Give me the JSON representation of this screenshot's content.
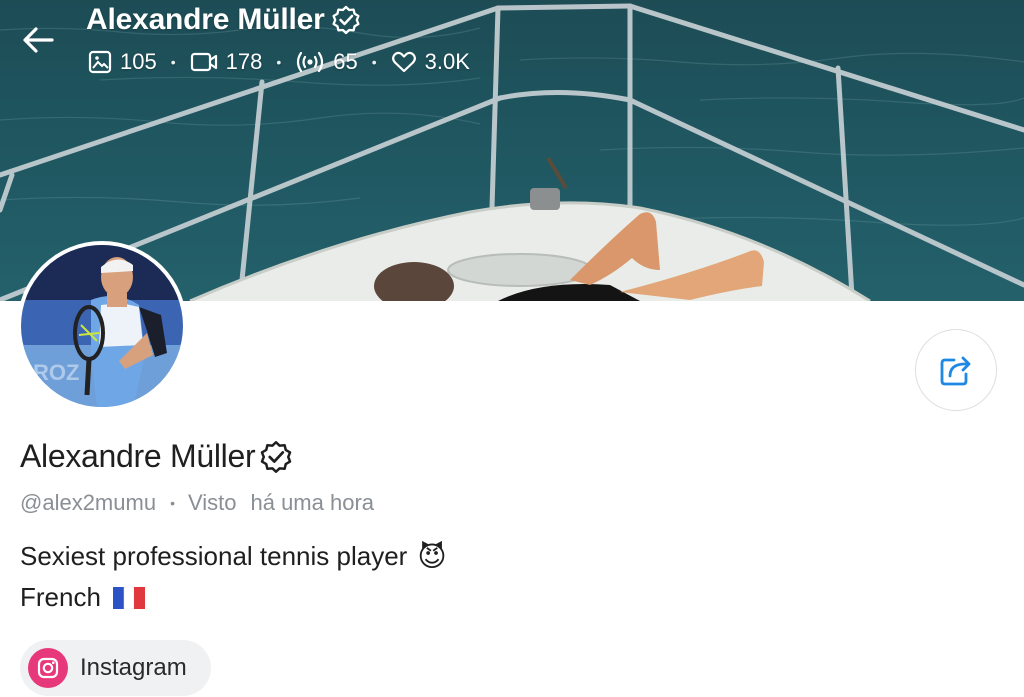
{
  "header": {
    "title": "Alexandre Müller",
    "stats": {
      "photos": "105",
      "videos": "178",
      "streams": "65",
      "likes": "3.0K"
    }
  },
  "profile": {
    "name": "Alexandre Müller",
    "username": "@alex2mumu",
    "seen_label": "Visto",
    "seen_time": "há uma hora",
    "bio_line1": "Sexiest professional tennis player",
    "bio_emoji": "😈",
    "bio_line2": "French",
    "bio_flag": "🇫🇷"
  },
  "links": {
    "instagram_label": "Instagram"
  },
  "icons": {
    "back": "arrow-left-icon",
    "verified": "verified-badge-icon",
    "photos": "image-icon",
    "videos": "video-camera-icon",
    "streams": "broadcast-icon",
    "likes": "heart-icon",
    "share": "share-icon",
    "instagram": "instagram-icon"
  },
  "colors": {
    "accent": "#1e88e5",
    "instagram": "#e6387a",
    "muted_text": "#8a8f96"
  }
}
